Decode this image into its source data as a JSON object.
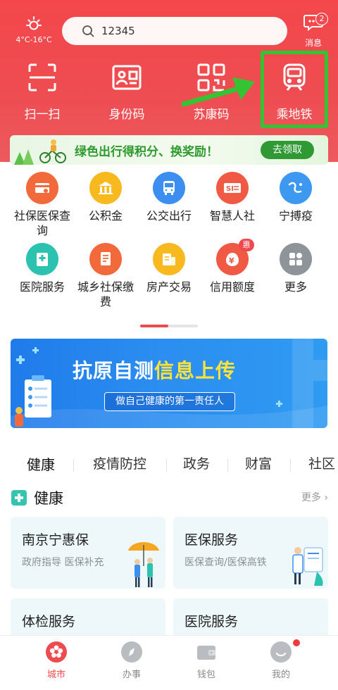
{
  "header": {
    "weather_temp": "4°C-16°C",
    "search_value": "12345",
    "messages_label": "消息",
    "messages_badge": "2"
  },
  "quick_actions": [
    {
      "label": "扫一扫",
      "icon": "scan-icon"
    },
    {
      "label": "身份码",
      "icon": "id-card-icon"
    },
    {
      "label": "苏康码",
      "icon": "qr-code-icon"
    },
    {
      "label": "乘地铁",
      "icon": "metro-icon"
    }
  ],
  "promo": {
    "text": "绿色出行得积分、换奖励！",
    "button": "去领取"
  },
  "services": [
    {
      "label": "社保医保查询",
      "color": "#f26a3c",
      "icon": "social-security-icon"
    },
    {
      "label": "公积金",
      "color": "#f8b91f",
      "icon": "housing-fund-icon"
    },
    {
      "label": "公交出行",
      "color": "#3c8ff0",
      "icon": "bus-icon"
    },
    {
      "label": "智慧人社",
      "color": "#f05a45",
      "icon": "smart-hr-icon"
    },
    {
      "label": "宁搏疫",
      "color": "#3c98f0",
      "icon": "epidemic-icon"
    },
    {
      "label": "医院服务",
      "color": "#2bc3b0",
      "icon": "hospital-icon"
    },
    {
      "label": "城乡社保缴费",
      "color": "#f26a3c",
      "icon": "payment-icon"
    },
    {
      "label": "房产交易",
      "color": "#f8b91f",
      "icon": "property-icon"
    },
    {
      "label": "信用额度",
      "color": "#f05a45",
      "icon": "credit-icon",
      "badge": "惠"
    },
    {
      "label": "更多",
      "color": "#8e9499",
      "icon": "more-apps-icon"
    }
  ],
  "banner": {
    "title_a": "抗原自测",
    "title_b": "信息上传",
    "subtitle": "做自己健康的第一责任人"
  },
  "tabs": [
    "健康",
    "疫情防控",
    "政务",
    "财富",
    "社区"
  ],
  "section": {
    "title": "健康",
    "more": "更多"
  },
  "cards": [
    {
      "title": "南京宁惠保",
      "sub": "政府指导 医保补充"
    },
    {
      "title": "医保服务",
      "sub": "医保查询/医保高铁"
    },
    {
      "title": "体检服务",
      "sub": ""
    },
    {
      "title": "医院服务",
      "sub": ""
    }
  ],
  "nav": [
    {
      "label": "城市",
      "icon": "city-icon",
      "active": true
    },
    {
      "label": "办事",
      "icon": "compass-icon",
      "active": false
    },
    {
      "label": "钱包",
      "icon": "wallet-icon",
      "active": false
    },
    {
      "label": "我的",
      "icon": "profile-icon",
      "active": false
    }
  ],
  "colors": {
    "brand_red": "#ee4b50",
    "highlight_green": "#34c433"
  }
}
